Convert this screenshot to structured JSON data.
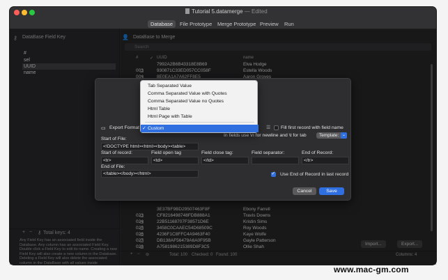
{
  "window": {
    "title": "Tutorial 5.datamerge",
    "title_suffix": "— Edited",
    "traffic_colors": [
      "#ff5f57",
      "#febc2e",
      "#28c840"
    ]
  },
  "toolbar": {
    "tabs": [
      {
        "label": "Database"
      },
      {
        "label": "File Prototype"
      },
      {
        "label": "Merge Prototype"
      },
      {
        "label": "Preview"
      },
      {
        "label": "Run"
      }
    ]
  },
  "sidebar": {
    "header": "DataBase Field Key",
    "items": [
      "#",
      "sel",
      "UUID",
      "name"
    ],
    "footer_label": "Total keys: 4",
    "help_text": "Any Field Key has an associated field inside the Database. Any column has an associated Field Key. Double click a Field Key to edit its name. Creating a new Field Key will also create a new column in the Database. Deleting a Field Key will also delete the associated column in the DataBase with all values inside"
  },
  "main": {
    "header": "DataBase to Merge",
    "search_placeholder": "Search",
    "columns": [
      "#",
      "✓",
      "UUID",
      "name"
    ],
    "rows_top": [
      {
        "n": "",
        "uuid": "7992A2B6B43318E8B69",
        "name": "Elva Hodge"
      },
      {
        "n": "003",
        "uuid": "930871C33ED057CC058F",
        "name": "Estella Woods"
      },
      {
        "n": "004",
        "uuid": "8E0EA1A7A62FF8E5",
        "name": "Aaron Groves"
      }
    ],
    "rows_bottom": [
      {
        "n": "",
        "uuid": "3E37BF9BD29507463F8F",
        "name": "Ebony Farrell"
      },
      {
        "n": "023",
        "uuid": "CF8216498748FDB888A1",
        "name": "Travis Downs"
      },
      {
        "n": "024",
        "uuid": "22B51168707F38571D6E",
        "name": "Kristin Sims"
      },
      {
        "n": "025",
        "uuid": "3458C0CAAEC54D68509C",
        "name": "Roy Woods"
      },
      {
        "n": "026",
        "uuid": "4236F1C8FFC4A9463F40",
        "name": "Kaye Wolfe"
      },
      {
        "n": "027",
        "uuid": "DB138AF56479A6A0F95B",
        "name": "Gayle Patterson"
      },
      {
        "n": "028",
        "uuid": "A7581986215389D8F3C5",
        "name": "Ollie Shah"
      }
    ],
    "footer": {
      "total": "Total: 100",
      "checked": "Checked: 0",
      "found": "Found: 100",
      "columns": "Columns: 4"
    },
    "import_label": "Import...",
    "export_label": "Export..."
  },
  "dialog": {
    "export_format_label": "Export Format",
    "fill_first_record_label": "Fill first record with field name",
    "hint": "In fields use \\n for newline and \\t for tab",
    "template_label": "Template:",
    "start_of_file_label": "Start of File:",
    "start_of_file_value": "<!DOCTYPE html><html><body><table>",
    "start_of_record_label": "Start of record:",
    "start_of_record_value": "<tr>",
    "field_open_tag_label": "Field open tag",
    "field_open_tag_value": "<td>",
    "field_close_tag_label": "Field close tag:",
    "field_close_tag_value": "</td>",
    "field_separator_label": "Field separator:",
    "field_separator_value": "",
    "end_of_record_label": "End of Record:",
    "end_of_record_value": "</tr>",
    "end_of_file_label": "End of File:",
    "end_of_file_value": "</table></body></html>",
    "use_end_of_record_label": "Use End of Record in last record",
    "cancel_label": "Cancel",
    "save_label": "Save"
  },
  "format_menu": {
    "items": [
      "Tab Separated Value",
      "Comma Separated Value with Quotes",
      "Comma Separated Value no Quotes",
      "Html Table",
      "Html Page with Table"
    ],
    "selected": "Custom"
  },
  "watermark": "www.mac-gm.com"
}
